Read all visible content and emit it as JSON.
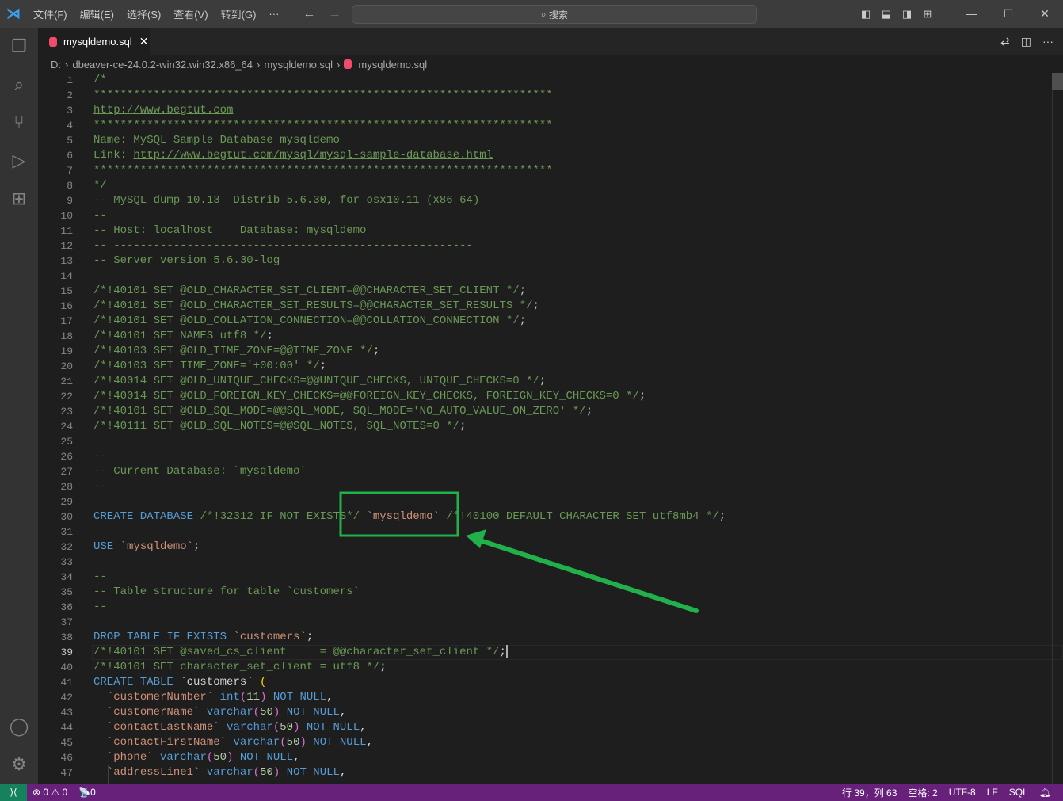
{
  "titlebar": {
    "menus": [
      "文件(F)",
      "编辑(E)",
      "选择(S)",
      "查看(V)",
      "转到(G)"
    ],
    "more": "···",
    "search_label": "搜索"
  },
  "tab": {
    "label": "mysqldemo.sql",
    "close": "✕"
  },
  "breadcrumb": [
    "D:",
    "dbeaver-ce-24.0.2-win32.win32.x86_64",
    "mysqldemo.sql",
    "mysqldemo.sql"
  ],
  "colors": {
    "accent": "#68217a",
    "annotation": "#22b04b",
    "remote": "#16825d"
  },
  "editor": {
    "current_line": 39,
    "lines": [
      [
        [
          "c",
          "/*"
        ]
      ],
      [
        [
          "c",
          "*********************************************************************"
        ]
      ],
      [
        [
          "c u",
          "http://www.begtut.com"
        ]
      ],
      [
        [
          "c",
          "*********************************************************************"
        ]
      ],
      [
        [
          "c",
          "Name: MySQL Sample Database mysqldemo"
        ]
      ],
      [
        [
          "c",
          "Link: "
        ],
        [
          "c u",
          "http://www.begtut.com/mysql/mysql-sample-database.html"
        ]
      ],
      [
        [
          "c",
          "*********************************************************************"
        ]
      ],
      [
        [
          "c",
          "*/"
        ]
      ],
      [
        [
          "c",
          "-- MySQL dump 10.13  Distrib 5.6.30, for osx10.11 (x86_64)"
        ]
      ],
      [
        [
          "c",
          "--"
        ]
      ],
      [
        [
          "c",
          "-- Host: localhost    Database: mysqldemo"
        ]
      ],
      [
        [
          "c",
          "-- ------------------------------------------------------"
        ]
      ],
      [
        [
          "c",
          "-- Server version 5.6.30-log"
        ]
      ],
      [],
      [
        [
          "c",
          "/*!40101 SET @OLD_CHARACTER_SET_CLIENT=@@CHARACTER_SET_CLIENT */"
        ],
        [
          "p",
          ";"
        ]
      ],
      [
        [
          "c",
          "/*!40101 SET @OLD_CHARACTER_SET_RESULTS=@@CHARACTER_SET_RESULTS */"
        ],
        [
          "p",
          ";"
        ]
      ],
      [
        [
          "c",
          "/*!40101 SET @OLD_COLLATION_CONNECTION=@@COLLATION_CONNECTION */"
        ],
        [
          "p",
          ";"
        ]
      ],
      [
        [
          "c",
          "/*!40101 SET NAMES utf8 */"
        ],
        [
          "p",
          ";"
        ]
      ],
      [
        [
          "c",
          "/*!40103 SET @OLD_TIME_ZONE=@@TIME_ZONE */"
        ],
        [
          "p",
          ";"
        ]
      ],
      [
        [
          "c",
          "/*!40103 SET TIME_ZONE='+00:00' */"
        ],
        [
          "p",
          ";"
        ]
      ],
      [
        [
          "c",
          "/*!40014 SET @OLD_UNIQUE_CHECKS=@@UNIQUE_CHECKS, UNIQUE_CHECKS=0 */"
        ],
        [
          "p",
          ";"
        ]
      ],
      [
        [
          "c",
          "/*!40014 SET @OLD_FOREIGN_KEY_CHECKS=@@FOREIGN_KEY_CHECKS, FOREIGN_KEY_CHECKS=0 */"
        ],
        [
          "p",
          ";"
        ]
      ],
      [
        [
          "c",
          "/*!40101 SET @OLD_SQL_MODE=@@SQL_MODE, SQL_MODE='NO_AUTO_VALUE_ON_ZERO' */"
        ],
        [
          "p",
          ";"
        ]
      ],
      [
        [
          "c",
          "/*!40111 SET @OLD_SQL_NOTES=@@SQL_NOTES, SQL_NOTES=0 */"
        ],
        [
          "p",
          ";"
        ]
      ],
      [],
      [
        [
          "c",
          "--"
        ]
      ],
      [
        [
          "c",
          "-- Current Database: `mysqldemo`"
        ]
      ],
      [
        [
          "c",
          "--"
        ]
      ],
      [],
      [
        [
          "k",
          "CREATE DATABASE"
        ],
        [
          "p",
          " "
        ],
        [
          "c",
          "/*!32312 IF NOT EXISTS*/"
        ],
        [
          "p",
          " "
        ],
        [
          "s",
          "`mysqldemo`"
        ],
        [
          "p",
          " "
        ],
        [
          "c",
          "/*!40100 DEFAULT CHARACTER SET utf8mb4 */"
        ],
        [
          "p",
          ";"
        ]
      ],
      [],
      [
        [
          "k",
          "USE"
        ],
        [
          "p",
          " "
        ],
        [
          "s",
          "`mysqldemo`"
        ],
        [
          "p",
          ";"
        ]
      ],
      [],
      [
        [
          "c",
          "--"
        ]
      ],
      [
        [
          "c",
          "-- Table structure for table `customers`"
        ]
      ],
      [
        [
          "c",
          "--"
        ]
      ],
      [],
      [
        [
          "k",
          "DROP TABLE IF EXISTS"
        ],
        [
          "p",
          " "
        ],
        [
          "s",
          "`customers`"
        ],
        [
          "p",
          ";"
        ]
      ],
      [
        [
          "c",
          "/*!40101 SET @saved_cs_client     = @@character_set_client */"
        ],
        [
          "p",
          ";"
        ]
      ],
      [
        [
          "c",
          "/*!40101 SET character_set_client = utf8 */"
        ],
        [
          "p",
          ";"
        ]
      ],
      [
        [
          "k",
          "CREATE TABLE"
        ],
        [
          "p",
          " `customers` "
        ],
        [
          "y",
          "("
        ]
      ],
      [
        [
          "p",
          "  "
        ],
        [
          "s",
          "`customerNumber`"
        ],
        [
          "p",
          " "
        ],
        [
          "k",
          "int"
        ],
        [
          "m",
          "("
        ],
        [
          "n",
          "11"
        ],
        [
          "m",
          ")"
        ],
        [
          "p",
          " "
        ],
        [
          "k",
          "NOT NULL"
        ],
        [
          "p",
          ","
        ]
      ],
      [
        [
          "p",
          "  "
        ],
        [
          "s",
          "`customerName`"
        ],
        [
          "p",
          " "
        ],
        [
          "k",
          "varchar"
        ],
        [
          "m",
          "("
        ],
        [
          "n",
          "50"
        ],
        [
          "m",
          ")"
        ],
        [
          "p",
          " "
        ],
        [
          "k",
          "NOT NULL"
        ],
        [
          "p",
          ","
        ]
      ],
      [
        [
          "p",
          "  "
        ],
        [
          "s",
          "`contactLastName`"
        ],
        [
          "p",
          " "
        ],
        [
          "k",
          "varchar"
        ],
        [
          "m",
          "("
        ],
        [
          "n",
          "50"
        ],
        [
          "m",
          ")"
        ],
        [
          "p",
          " "
        ],
        [
          "k",
          "NOT NULL"
        ],
        [
          "p",
          ","
        ]
      ],
      [
        [
          "p",
          "  "
        ],
        [
          "s",
          "`contactFirstName`"
        ],
        [
          "p",
          " "
        ],
        [
          "k",
          "varchar"
        ],
        [
          "m",
          "("
        ],
        [
          "n",
          "50"
        ],
        [
          "m",
          ")"
        ],
        [
          "p",
          " "
        ],
        [
          "k",
          "NOT NULL"
        ],
        [
          "p",
          ","
        ]
      ],
      [
        [
          "p",
          "  "
        ],
        [
          "s",
          "`phone`"
        ],
        [
          "p",
          " "
        ],
        [
          "k",
          "varchar"
        ],
        [
          "m",
          "("
        ],
        [
          "n",
          "50"
        ],
        [
          "m",
          ")"
        ],
        [
          "p",
          " "
        ],
        [
          "k",
          "NOT NULL"
        ],
        [
          "p",
          ","
        ]
      ],
      [
        [
          "p",
          "  "
        ],
        [
          "s",
          "`addressLine1`"
        ],
        [
          "p",
          " "
        ],
        [
          "k",
          "varchar"
        ],
        [
          "m",
          "("
        ],
        [
          "n",
          "50"
        ],
        [
          "m",
          ")"
        ],
        [
          "p",
          " "
        ],
        [
          "k",
          "NOT NULL"
        ],
        [
          "p",
          ","
        ]
      ]
    ]
  },
  "status": {
    "errors": "0",
    "warnings": "0",
    "ports": "0",
    "position": "行 39，列 63",
    "spaces": "空格: 2",
    "encoding": "UTF-8",
    "eol": "LF",
    "language": "SQL"
  }
}
